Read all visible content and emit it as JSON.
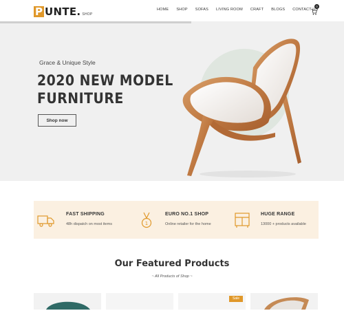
{
  "header": {
    "logo_letter": "P",
    "logo_text": "UNTE.",
    "logo_sub": "SHOP",
    "nav": [
      "HOME",
      "SHOP",
      "SOFAS",
      "LIVING ROOM",
      "CRAFT",
      "BLOGS",
      "CONTACT US"
    ],
    "cart_count": "0"
  },
  "hero": {
    "subtitle": "Grace & Unique Style",
    "title_line1": "2020 NEW MODEL",
    "title_line2": "FURNITURE",
    "button": "Shop now"
  },
  "features": [
    {
      "icon": "truck-icon",
      "title": "FAST SHIPPING",
      "desc": "48h dispatch on most items"
    },
    {
      "icon": "medal-icon",
      "title": "EURO NO.1 SHOP",
      "desc": "Online retailer for the home"
    },
    {
      "icon": "cabinet-icon",
      "title": "HUGE RANGE",
      "desc": "13000 + products available"
    }
  ],
  "products": {
    "title": "Our Featured Products",
    "subtitle": "~ All Products of Shop ~",
    "sale_label": "Sale"
  },
  "colors": {
    "accent": "#e0982a",
    "hero_bg": "#f0f0f0",
    "feature_bg": "#fbf0e1"
  }
}
